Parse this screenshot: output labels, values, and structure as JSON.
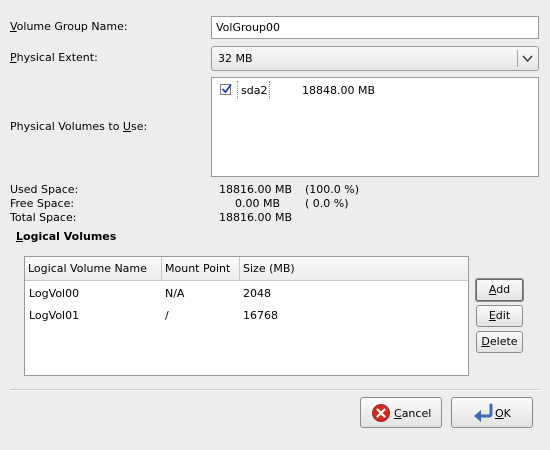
{
  "form": {
    "vg_name_label": "Volume Group Name:",
    "vg_name_value": "VolGroup00",
    "pe_label": "Physical Extent:",
    "pe_value": "32 MB",
    "pv_label": "Physical Volumes to Use:",
    "pv_list": [
      {
        "checked": true,
        "device": "sda2",
        "size": "18848.00 MB"
      }
    ]
  },
  "space": {
    "used_label": "Used Space:",
    "used_value": "18816.00 MB",
    "used_pct": "(100.0 %)",
    "free_label": "Free Space:",
    "free_value": "0.00 MB",
    "free_pct": "( 0.0 %)",
    "total_label": "Total Space:",
    "total_value": "18816.00 MB"
  },
  "logical_volumes": {
    "section_title": "Logical Volumes",
    "columns": [
      "Logical Volume Name",
      "Mount Point",
      "Size (MB)"
    ],
    "rows": [
      {
        "name": "LogVol00",
        "mount": "N/A",
        "size": "2048"
      },
      {
        "name": "LogVol01",
        "mount": "/",
        "size": "16768"
      }
    ],
    "add_label": "Add",
    "edit_label": "Edit",
    "delete_label": "Delete"
  },
  "dialog": {
    "cancel_label": "Cancel",
    "ok_label": "OK"
  },
  "colors": {
    "background": "#ededed",
    "cancel_icon": "#d42b1e"
  }
}
